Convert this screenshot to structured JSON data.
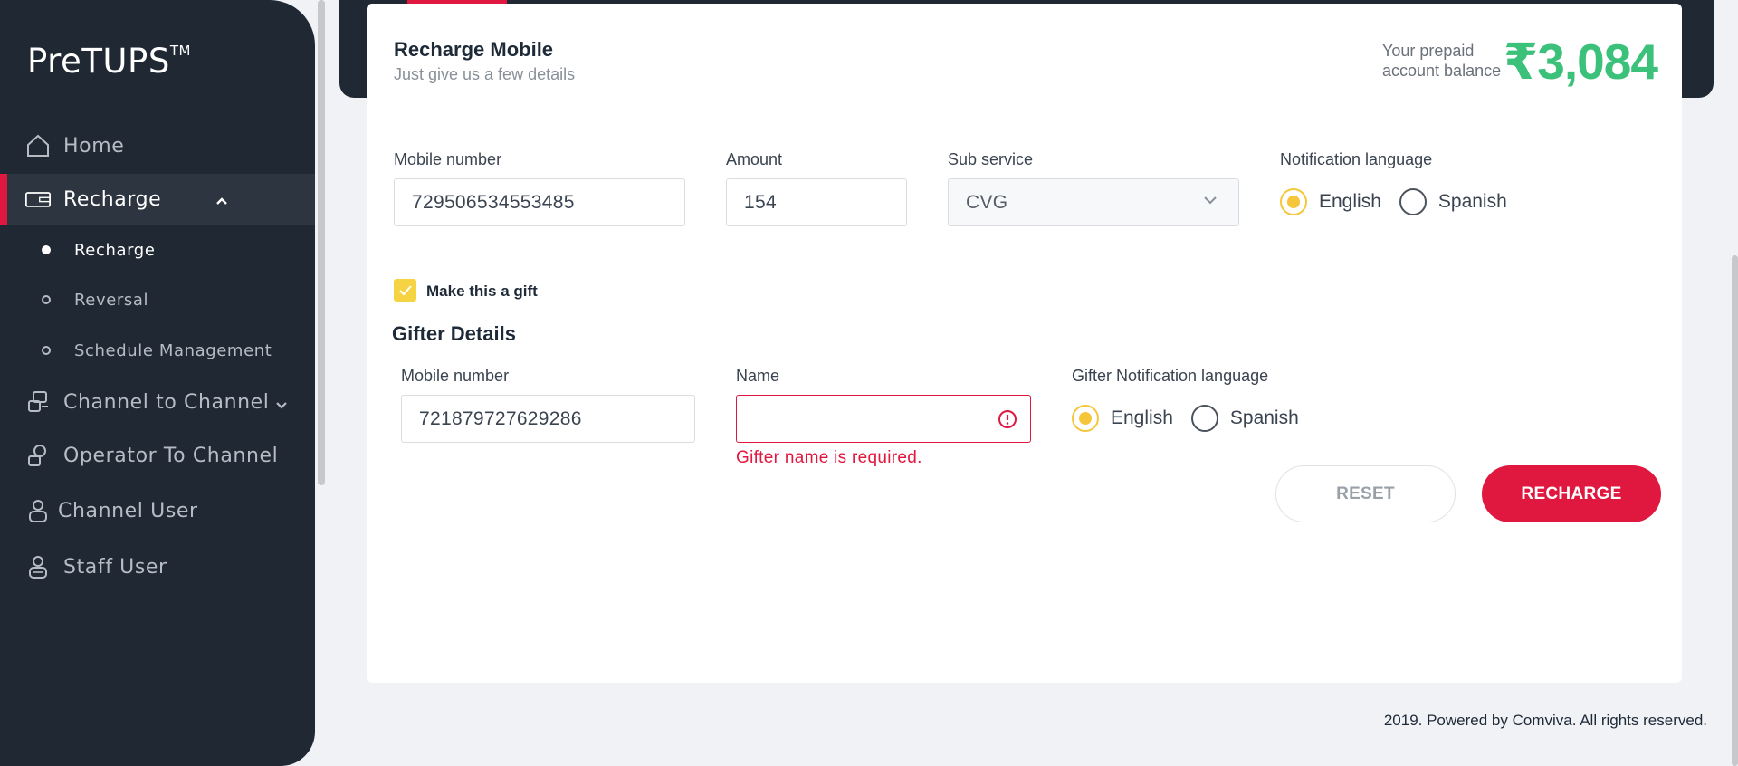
{
  "app": {
    "brand": "PreTUPS",
    "brand_mark": "TM"
  },
  "sidebar": {
    "items": [
      {
        "label": "Home",
        "icon": "home-icon"
      },
      {
        "label": "Recharge",
        "icon": "wallet-icon",
        "expanded": true
      },
      {
        "label": "Channel to Channel",
        "icon": "transfer-icon"
      },
      {
        "label": "Operator To Channel",
        "icon": "operator-icon"
      },
      {
        "label": "Channel User",
        "icon": "user-icon"
      },
      {
        "label": "Staff User",
        "icon": "staff-icon"
      }
    ],
    "sub_items": [
      {
        "label": "Recharge",
        "active": true
      },
      {
        "label": "Reversal"
      },
      {
        "label": "Schedule Management"
      }
    ]
  },
  "card": {
    "title": "Recharge Mobile",
    "subtitle": "Just give us a few details",
    "balance_label": "Your prepaid account balance",
    "balance_value": "₹3,084"
  },
  "form": {
    "mobile_label": "Mobile number",
    "mobile_value": "729506534553485",
    "amount_label": "Amount",
    "amount_value": "154",
    "subservice_label": "Sub service",
    "subservice_value": "CVG",
    "notif_label": "Notification language",
    "notif_options": [
      "English",
      "Spanish"
    ],
    "notif_selected": "English",
    "gift_label": "Make this a gift",
    "gift_checked": true
  },
  "gifter": {
    "title": "Gifter Details",
    "mobile_label": "Mobile number",
    "mobile_value": "721879727629286",
    "name_label": "Name",
    "name_value": "",
    "name_error": "Gifter name is required.",
    "notif_label": "Gifter Notification language",
    "notif_options": [
      "English",
      "Spanish"
    ],
    "notif_selected": "English"
  },
  "actions": {
    "reset": "RESET",
    "recharge": "RECHARGE"
  },
  "footer": {
    "text": "2019. Powered by Comviva. All rights reserved."
  },
  "colors": {
    "accent": "#e0173f",
    "balance": "#3cc17a",
    "radio": "#f6c63a",
    "sidebar": "#1f2833"
  }
}
